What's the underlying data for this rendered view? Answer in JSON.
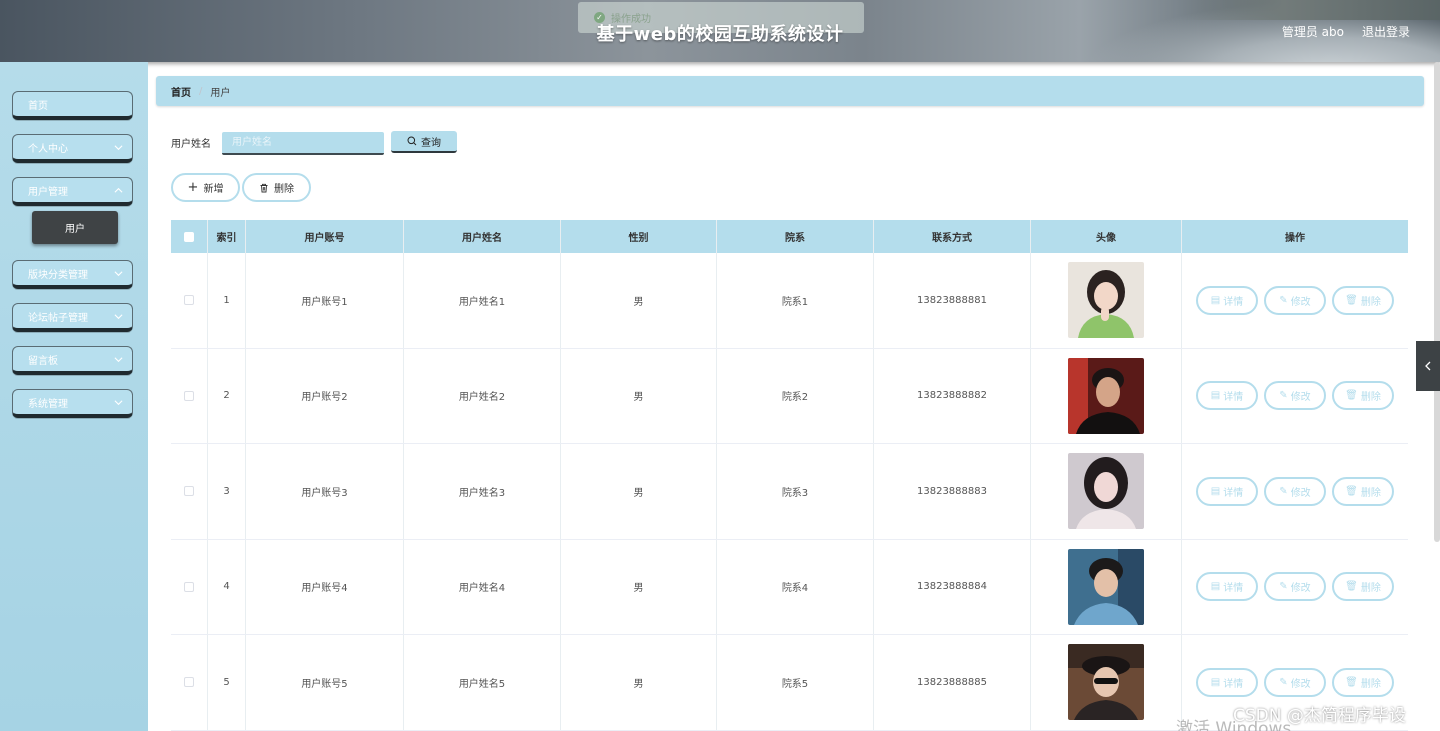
{
  "header": {
    "title": "基于web的校园互助系统设计",
    "user_label": "管理员 abo",
    "logout_label": "退出登录",
    "toast_text": "操作成功"
  },
  "sidebar": {
    "items": [
      {
        "label": "首页"
      },
      {
        "label": "个人中心"
      },
      {
        "label": "用户管理"
      },
      {
        "label": "版块分类管理"
      },
      {
        "label": "论坛帖子管理"
      },
      {
        "label": "留言板"
      },
      {
        "label": "系统管理"
      }
    ],
    "active_sub": "用户"
  },
  "breadcrumb": {
    "home": "首页",
    "sep": "/",
    "current": "用户"
  },
  "search": {
    "label": "用户姓名",
    "placeholder": "用户姓名",
    "button": "查询"
  },
  "actions": {
    "add": "新增",
    "delete": "删除"
  },
  "table": {
    "headers": [
      "索引",
      "用户账号",
      "用户姓名",
      "性别",
      "院系",
      "联系方式",
      "头像",
      "操作"
    ],
    "rows": [
      {
        "index": "1",
        "account": "用户账号1",
        "name": "用户姓名1",
        "gender": "男",
        "dept": "院系1",
        "phone": "13823888881"
      },
      {
        "index": "2",
        "account": "用户账号2",
        "name": "用户姓名2",
        "gender": "男",
        "dept": "院系2",
        "phone": "13823888882"
      },
      {
        "index": "3",
        "account": "用户账号3",
        "name": "用户姓名3",
        "gender": "男",
        "dept": "院系3",
        "phone": "13823888883"
      },
      {
        "index": "4",
        "account": "用户账号4",
        "name": "用户姓名4",
        "gender": "男",
        "dept": "院系4",
        "phone": "13823888884"
      },
      {
        "index": "5",
        "account": "用户账号5",
        "name": "用户姓名5",
        "gender": "男",
        "dept": "院系5",
        "phone": "13823888885"
      }
    ],
    "ops": {
      "detail": "详情",
      "edit": "修改",
      "delete": "删除"
    }
  },
  "watermark": {
    "text": "CSDN @杰简程序毕设",
    "os_text": "激活 Windows"
  },
  "colors": {
    "accent": "#b4ddec",
    "sidebar_bg": "#a6d3e4",
    "dark": "#3f4345"
  }
}
